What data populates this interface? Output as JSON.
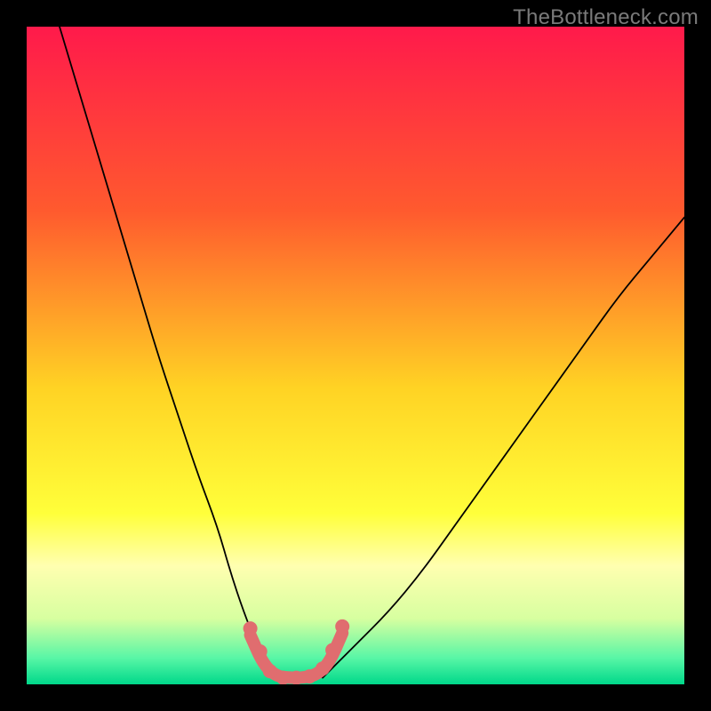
{
  "watermark": "TheBottleneck.com",
  "chart_data": {
    "type": "line",
    "title": "",
    "xlabel": "",
    "ylabel": "",
    "xlim": [
      0,
      100
    ],
    "ylim": [
      0,
      100
    ],
    "grid": false,
    "legend": false,
    "background_gradient": {
      "stops": [
        {
          "offset": 0.0,
          "color": "#ff1a4b"
        },
        {
          "offset": 0.28,
          "color": "#ff5a2e"
        },
        {
          "offset": 0.55,
          "color": "#ffd324"
        },
        {
          "offset": 0.74,
          "color": "#ffff3a"
        },
        {
          "offset": 0.82,
          "color": "#ffffb0"
        },
        {
          "offset": 0.9,
          "color": "#d7ffa0"
        },
        {
          "offset": 0.96,
          "color": "#58f6a6"
        },
        {
          "offset": 1.0,
          "color": "#00d88a"
        }
      ]
    },
    "series": [
      {
        "name": "left-limb",
        "stroke": "#000000",
        "stroke_width": 1.8,
        "x": [
          5,
          8,
          11,
          14,
          17,
          20,
          23,
          26,
          29,
          31,
          33,
          35,
          36.5,
          38
        ],
        "y": [
          100,
          90,
          80,
          70,
          60,
          50,
          41,
          32,
          24,
          17,
          11,
          6,
          3,
          1
        ]
      },
      {
        "name": "right-limb",
        "stroke": "#000000",
        "stroke_width": 1.8,
        "x": [
          45,
          47,
          50,
          55,
          60,
          65,
          70,
          75,
          80,
          85,
          90,
          95,
          100
        ],
        "y": [
          1,
          3,
          6,
          11,
          17,
          24,
          31,
          38,
          45,
          52,
          59,
          65,
          71
        ]
      },
      {
        "name": "valley-floor-band",
        "stroke": "#e06d6f",
        "stroke_width": 14,
        "x": [
          34,
          36,
          38,
          40,
          42,
          44,
          46,
          48
        ],
        "y": [
          7.5,
          3.0,
          1.2,
          1.0,
          1.0,
          1.4,
          3.2,
          7.8
        ]
      },
      {
        "name": "valley-markers",
        "type": "scatter",
        "fill": "#e06d6f",
        "r": 8,
        "x": [
          34,
          35.5,
          37,
          39,
          41,
          43,
          45,
          46.5,
          48
        ],
        "y": [
          8.5,
          5.0,
          2.0,
          1.0,
          1.0,
          1.2,
          2.4,
          5.2,
          8.8
        ]
      }
    ]
  }
}
